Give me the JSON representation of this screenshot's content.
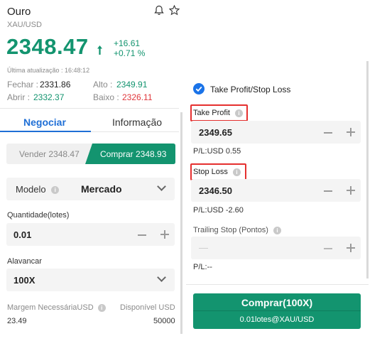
{
  "header": {
    "title": "Ouro",
    "symbol": "XAU/USD",
    "price": "2348.47",
    "change_abs": "+16.61",
    "change_pct": "+0.71 %",
    "last_update": "Última atualização : 16:48:12"
  },
  "stats": {
    "close_label": "Fechar :",
    "close_value": "2331.86",
    "high_label": "Alto :",
    "high_value": "2349.91",
    "open_label": "Abrir :",
    "open_value": "2332.37",
    "low_label": "Baixo :",
    "low_value": "2326.11"
  },
  "tabs": {
    "trade": "Negociar",
    "info": "Informação"
  },
  "order": {
    "sell_label": "Vender 2348.47",
    "buy_label": "Comprar 2348.93",
    "model_label": "Modelo",
    "model_value": "Mercado",
    "quantity_label": "Quantidade(lotes)",
    "quantity_value": "0.01",
    "leverage_label": "Alavancar",
    "leverage_value": "100X",
    "margin_label": "Margem NecessáriaUSD",
    "margin_value": "23.49",
    "available_label": "Disponível USD",
    "available_value": "50000"
  },
  "tpsl": {
    "checkbox_label": "Take Profit/Stop Loss",
    "tp_label": "Take Profit",
    "tp_value": "2349.65",
    "tp_pl": "P/L:USD 0.55",
    "sl_label": "Stop Loss",
    "sl_value": "2346.50",
    "sl_pl": "P/L:USD -2.60",
    "trailing_label": "Trailing Stop (Pontos)",
    "trailing_value": "—",
    "trailing_pl": "P/L:--"
  },
  "submit": {
    "title": "Comprar(100X)",
    "subtitle": "0.01lotes@XAU/USD"
  },
  "colors": {
    "accent_green": "#13946f",
    "loss_red": "#e0373c",
    "highlight_red": "#e5302f",
    "tab_blue": "#1f6fd6",
    "checkbox_blue": "#1a73e8"
  }
}
